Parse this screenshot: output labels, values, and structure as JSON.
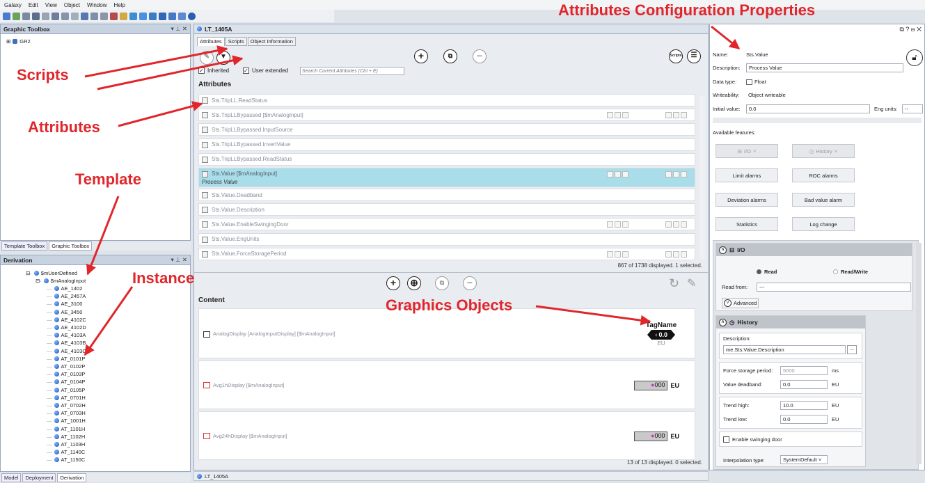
{
  "menu": [
    "Galaxy",
    "Edit",
    "View",
    "Object",
    "Window",
    "Help"
  ],
  "toolbox": {
    "title": "Graphic Toolbox",
    "root": "GR2",
    "tabs": [
      "Template Toolbox",
      "Graphic Toolbox"
    ]
  },
  "derivation": {
    "title": "Derivation",
    "root": "$mUserDefined",
    "child": "$mAnalogInput",
    "items": [
      "AE_1402",
      "AE_2457A",
      "AE_3100",
      "AE_3450",
      "AE_4102C",
      "AE_4102D",
      "AE_4103A",
      "AE_4103B",
      "AE_4103C",
      "AT_0101P",
      "AT_0102P",
      "AT_0103P",
      "AT_0104P",
      "AT_0105P",
      "AT_0701H",
      "AT_0702H",
      "AT_0703H",
      "AT_1001H",
      "AT_1101H",
      "AT_1102H",
      "AT_1103H",
      "AT_1140C",
      "AT_1150C"
    ],
    "tabs": [
      "Model",
      "Deployment",
      "Derivation"
    ]
  },
  "editor": {
    "title": "LT_1405A",
    "tabs": [
      "Attributes",
      "Scripts",
      "Object Information"
    ],
    "inherited_label": "Inherited",
    "user_extended_label": "User extended",
    "search_placeholder": "Search Current Attributes (Ctrl + E)",
    "scripts_btn": "Scripts",
    "attributes_heading": "Attributes",
    "attributes": [
      {
        "name": "Sts.TripLL.ReadStatus"
      },
      {
        "name": "Sts.TripLLBypassed [$mAnalogInput]"
      },
      {
        "name": "Sts.TripLLBypassed.InputSource"
      },
      {
        "name": "Sts.TripLLBypassed.InvertValue"
      },
      {
        "name": "Sts.TripLLBypassed.ReadStatus"
      },
      {
        "name": "Sts.Value [$mAnalogInput]",
        "sub": "Process Value",
        "selected": true
      },
      {
        "name": "Sts.Value.Deadband"
      },
      {
        "name": "Sts.Value.Description"
      },
      {
        "name": "Sts.Value.EnableSwingingDoor"
      },
      {
        "name": "Sts.Value.EngUnits"
      },
      {
        "name": "Sts.Value.ForceStoragePeriod"
      }
    ],
    "attr_status": "867 of 1738 displayed. 1 selected.",
    "content_heading": "Content",
    "content": [
      {
        "name": "AnalogDisplay [AnalogInputDisplay] [$mAnalogInput]",
        "tag": "TagName",
        "value": "0.0",
        "unit": "EU"
      },
      {
        "name": "Avg1hDisplay [$mAnalogInput]",
        "value": "000",
        "unit": "EU"
      },
      {
        "name": "Avg24hDisplay [$mAnalogInput]",
        "value": "000",
        "unit": "EU"
      }
    ],
    "content_status": "13 of 13 displayed. 0 selected.",
    "footer": "LT_1405A"
  },
  "props": {
    "name_label": "Name:",
    "name_value": "Sts.Value",
    "desc_label": "Description:",
    "desc_value": "Process Value",
    "dtype_label": "Data type:",
    "dtype_value": "Float",
    "write_label": "Writeability:",
    "write_value": "Object writeable",
    "init_label": "Initial value:",
    "init_value": "0.0",
    "eng_label": "Eng units:",
    "eng_value": "--",
    "features_label": "Available features:",
    "features": [
      "I/O",
      "History",
      "Limit alarms",
      "ROC alarms",
      "Deviation alarms",
      "Bad value alarm",
      "Statistics",
      "Log change"
    ],
    "io": {
      "title": "I/O",
      "read": "Read",
      "readwrite": "Read/Write",
      "read_from_label": "Read from:",
      "read_from_value": "---",
      "advanced": "Advanced"
    },
    "history": {
      "title": "History",
      "desc_label": "Description:",
      "desc_value": "me.Sts.Value.Description",
      "fsp_label": "Force storage period:",
      "fsp_value": "5000",
      "fsp_unit": "ms",
      "vd_label": "Value deadband:",
      "vd_value": "0.0",
      "vd_unit": "EU",
      "th_label": "Trend high:",
      "th_value": "10.0",
      "th_unit": "EU",
      "tl_label": "Trend low:",
      "tl_value": "0.0",
      "tl_unit": "EU",
      "swing_label": "Enable swinging door",
      "interp_label": "Interpolation type:",
      "interp_value": "SystemDefault"
    }
  },
  "annotations": {
    "title": "Attributes Configuration Properties",
    "scripts": "Scripts",
    "attributes": "Attributes",
    "template": "Template",
    "instance": "Instance",
    "graphics": "Graphics Objects"
  }
}
